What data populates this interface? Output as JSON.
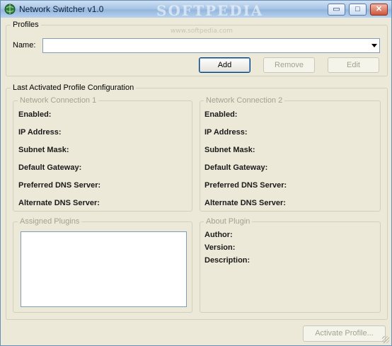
{
  "window": {
    "title": "Network Switcher v1.0",
    "watermark": "SOFTPEDIA",
    "watermark_url": "www.softpedia.com",
    "controls": {
      "minimize": "▭",
      "maximize": "□",
      "close": "✕"
    }
  },
  "profiles": {
    "group_title": "Profiles",
    "name_label": "Name:",
    "name_value": "",
    "add_label": "Add",
    "remove_label": "Remove",
    "edit_label": "Edit"
  },
  "config": {
    "group_title": "Last Activated Profile Configuration",
    "connection1": {
      "title": "Network Connection 1",
      "enabled": "Enabled:",
      "ip": "IP Address:",
      "subnet": "Subnet Mask:",
      "gateway": "Default Gateway:",
      "pdns": "Preferred DNS Server:",
      "adns": "Alternate DNS Server:"
    },
    "connection2": {
      "title": "Network Connection 2",
      "enabled": "Enabled:",
      "ip": "IP Address:",
      "subnet": "Subnet Mask:",
      "gateway": "Default Gateway:",
      "pdns": "Preferred DNS Server:",
      "adns": "Alternate DNS Server:"
    },
    "plugins": {
      "title": "Assigned Plugins"
    },
    "about": {
      "title": "About Plugin",
      "author": "Author:",
      "version": "Version:",
      "description": "Description:"
    }
  },
  "footer": {
    "activate_label": "Activate Profile..."
  }
}
